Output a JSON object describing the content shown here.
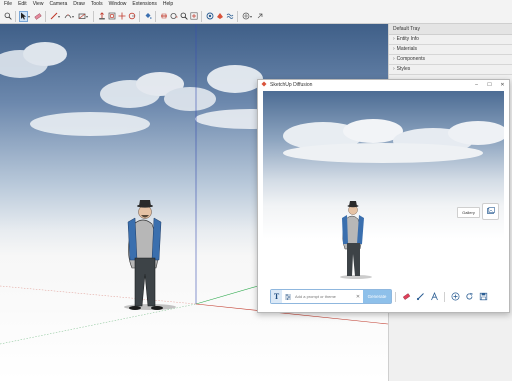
{
  "menubar": {
    "items": [
      "File",
      "Edit",
      "View",
      "Camera",
      "Draw",
      "Tools",
      "Window",
      "Extensions",
      "Help"
    ]
  },
  "tray": {
    "title": "Default Tray",
    "panels": [
      "Entity Info",
      "Materials",
      "Components",
      "Styles"
    ]
  },
  "dialog": {
    "title": "SketchUp Diffusion",
    "minimize": "–",
    "maximize": "☐",
    "close": "✕",
    "gallery_label": "Gallery",
    "prompt_placeholder": "Add a prompt or theme",
    "generate_label": "Generate",
    "text_mode_glyph": "T"
  }
}
